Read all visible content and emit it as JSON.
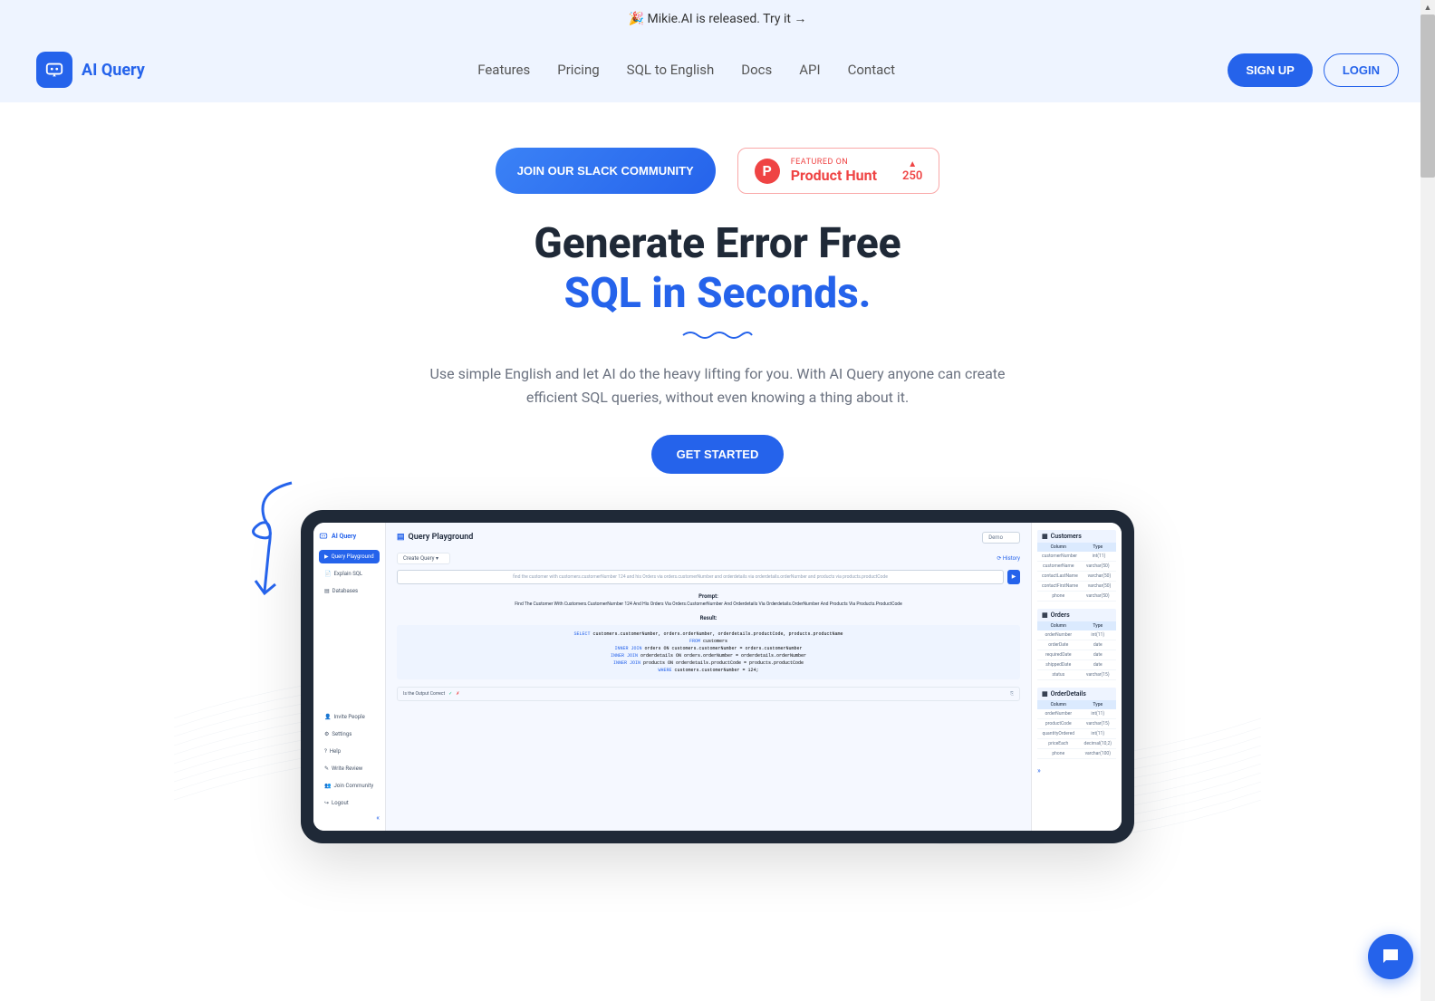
{
  "announcement": {
    "text": "🎉  Mikie.AI is released. Try it →"
  },
  "nav": {
    "brand": "AI Query",
    "links": [
      "Features",
      "Pricing",
      "SQL to English",
      "Docs",
      "API",
      "Contact"
    ],
    "signup": "SIGN UP",
    "login": "LOGIN"
  },
  "hero": {
    "slack_btn": "JOIN OUR SLACK COMMUNITY",
    "ph_featured": "FEATURED ON",
    "ph_name": "Product Hunt",
    "ph_votes": "250",
    "title_line1": "Generate Error Free",
    "title_line2": "SQL in Seconds.",
    "description": "Use simple English and let AI do the heavy lifting for you. With AI Query anyone can create efficient SQL queries, without even knowing a thing about it.",
    "get_started": "GET STARTED"
  },
  "app": {
    "brand": "AI Query",
    "sidebar_items": [
      "Query Playground",
      "Explain SQL",
      "Databases"
    ],
    "sidebar_bottom": [
      "Invite People",
      "Settings",
      "Help",
      "Write Review",
      "Join Community",
      "Logout"
    ],
    "main_title": "Query Playground",
    "demo_label": "Demo",
    "create_query": "Create Query",
    "history": "History",
    "query_input": "find the customer with customers.customerNumber 124 and his Orders via orders.customerNumber and orderdetails via orderdetails.orderNumber and products via products.productCode",
    "prompt_label": "Prompt:",
    "prompt_text": "Find The Customer With Customers.CustomerNumber 124 And His Orders Via Orders.CustomerNumber And Orderdetails Via Orderdetails.OrderNumber And Products Via Products.ProductCode",
    "result_label": "Result:",
    "sql_lines": [
      {
        "kw": "SELECT",
        "rest": " customers.customerNumber, orders.orderNumber, orderdetails.productCode, products.productName"
      },
      {
        "kw": "FROM",
        "rest": " customers"
      },
      {
        "kw": "INNER JOIN",
        "rest": " orders ON customers.customerNumber = orders.customerNumber"
      },
      {
        "kw": "INNER JOIN",
        "rest": " orderdetails ON orders.orderNumber = orderdetails.orderNumber"
      },
      {
        "kw": "INNER JOIN",
        "rest": " products ON orderdetails.productCode = products.productCode"
      },
      {
        "kw": "WHERE",
        "rest": " customers.customerNumber = 124;"
      }
    ],
    "output_correct": "Is the Output Correct",
    "tables": [
      {
        "name": "Customers",
        "col_header": "Column",
        "type_header": "Type",
        "rows": [
          {
            "c": "customerNumber",
            "t": "int(11)"
          },
          {
            "c": "customerName",
            "t": "varchar(50)"
          },
          {
            "c": "contactLastName",
            "t": "varchar(50)"
          },
          {
            "c": "contactFirstName",
            "t": "varchar(50)"
          },
          {
            "c": "phone",
            "t": "varchar(50)"
          }
        ]
      },
      {
        "name": "Orders",
        "col_header": "Column",
        "type_header": "Type",
        "rows": [
          {
            "c": "orderNumber",
            "t": "int(11)"
          },
          {
            "c": "orderDate",
            "t": "date"
          },
          {
            "c": "requiredDate",
            "t": "date"
          },
          {
            "c": "shippedDate",
            "t": "date"
          },
          {
            "c": "status",
            "t": "varchar(15)"
          }
        ]
      },
      {
        "name": "OrderDetails",
        "col_header": "Column",
        "type_header": "Type",
        "rows": [
          {
            "c": "orderNumber",
            "t": "int(11)"
          },
          {
            "c": "productCode",
            "t": "varchar(15)"
          },
          {
            "c": "quantityOrdered",
            "t": "int(11)"
          },
          {
            "c": "priceEach",
            "t": "decimal(10,2)"
          },
          {
            "c": "phone",
            "t": "varchar(100)"
          }
        ]
      }
    ]
  }
}
